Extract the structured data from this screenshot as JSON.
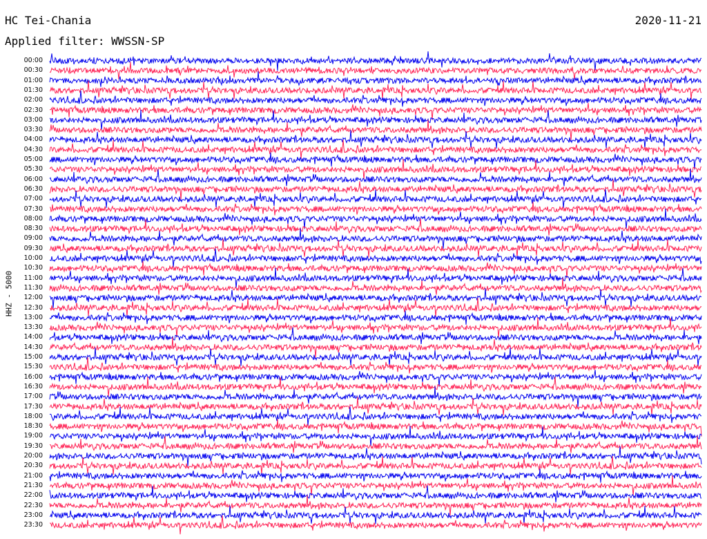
{
  "header": {
    "station": "HC Tei-Chania",
    "filter_label": "Applied filter:",
    "filter_value": "WWSSN-SP",
    "date": "2020-11-21"
  },
  "side_label": "HHZ - 5000",
  "chart_data": {
    "type": "line",
    "title": "HC Tei-Chania",
    "date": "2020-11-21",
    "channel_label": "HHZ - 5000",
    "filter": "WWSSN-SP",
    "row_labels": [
      "00:00",
      "00:30",
      "01:00",
      "01:30",
      "02:00",
      "02:30",
      "03:00",
      "03:30",
      "04:00",
      "04:30",
      "05:00",
      "05:30",
      "06:00",
      "06:30",
      "07:00",
      "07:30",
      "08:00",
      "08:30",
      "09:00",
      "09:30",
      "10:00",
      "10:30",
      "11:00",
      "11:30",
      "12:00",
      "12:30",
      "13:00",
      "13:30",
      "14:00",
      "14:30",
      "15:00",
      "15:30",
      "16:00",
      "16:30",
      "17:00",
      "17:30",
      "18:00",
      "18:30",
      "19:00",
      "19:30",
      "20:00",
      "20:30",
      "21:00",
      "21:30",
      "22:00",
      "22:30",
      "23:00",
      "23:30"
    ],
    "row_colors": [
      "#0000ee",
      "#ff2255"
    ]
  }
}
